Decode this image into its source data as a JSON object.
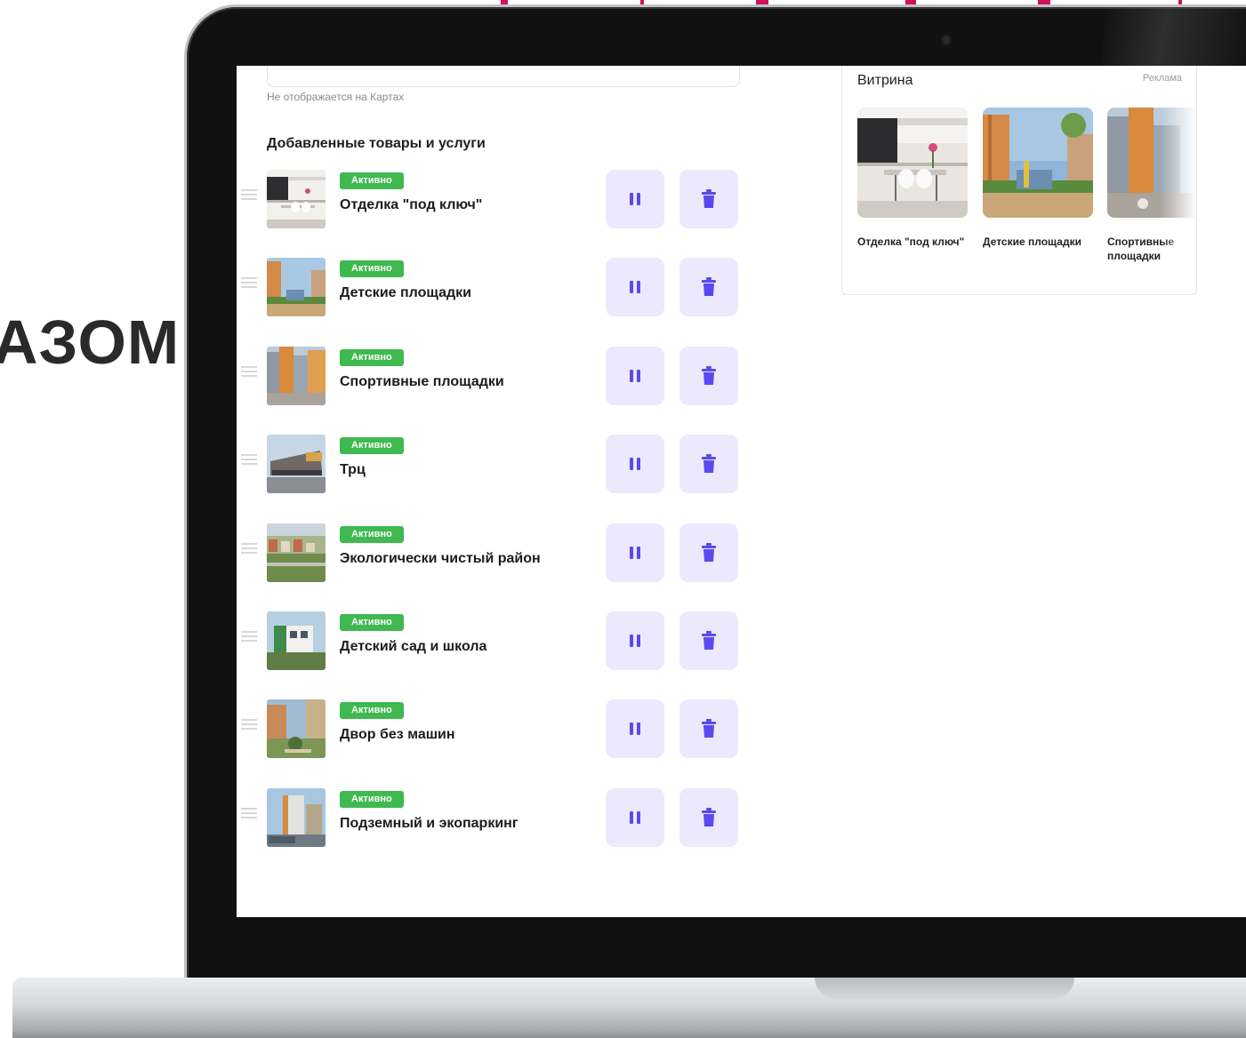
{
  "background": {
    "heading_fragment": "АЗОМ"
  },
  "form": {
    "field_note": "Не отображается на Картах"
  },
  "products": {
    "section_title": "Добавленные товары и услуги",
    "items": [
      {
        "status": "Активно",
        "title": "Отделка \"под ключ\""
      },
      {
        "status": "Активно",
        "title": "Детские площадки"
      },
      {
        "status": "Активно",
        "title": "Спортивные площадки"
      },
      {
        "status": "Активно",
        "title": "Трц"
      },
      {
        "status": "Активно",
        "title": "Экологически чистый район"
      },
      {
        "status": "Активно",
        "title": "Детский сад и школа"
      },
      {
        "status": "Активно",
        "title": "Двор без машин"
      },
      {
        "status": "Активно",
        "title": "Подземный и экопаркинг"
      }
    ],
    "pause_icon": "pause-icon",
    "delete_icon": "trash-icon"
  },
  "showcase": {
    "title": "Витрина",
    "ad_label": "Реклама",
    "items": [
      {
        "label": "Отделка \"под ключ\""
      },
      {
        "label": "Детские площадки"
      },
      {
        "label": "Спортивные площадки"
      }
    ]
  },
  "colors": {
    "badge_green": "#3fb950",
    "action_bg": "#ebe9fb",
    "action_icon": "#5b49f0",
    "accent_magenta": "#d0115c"
  }
}
